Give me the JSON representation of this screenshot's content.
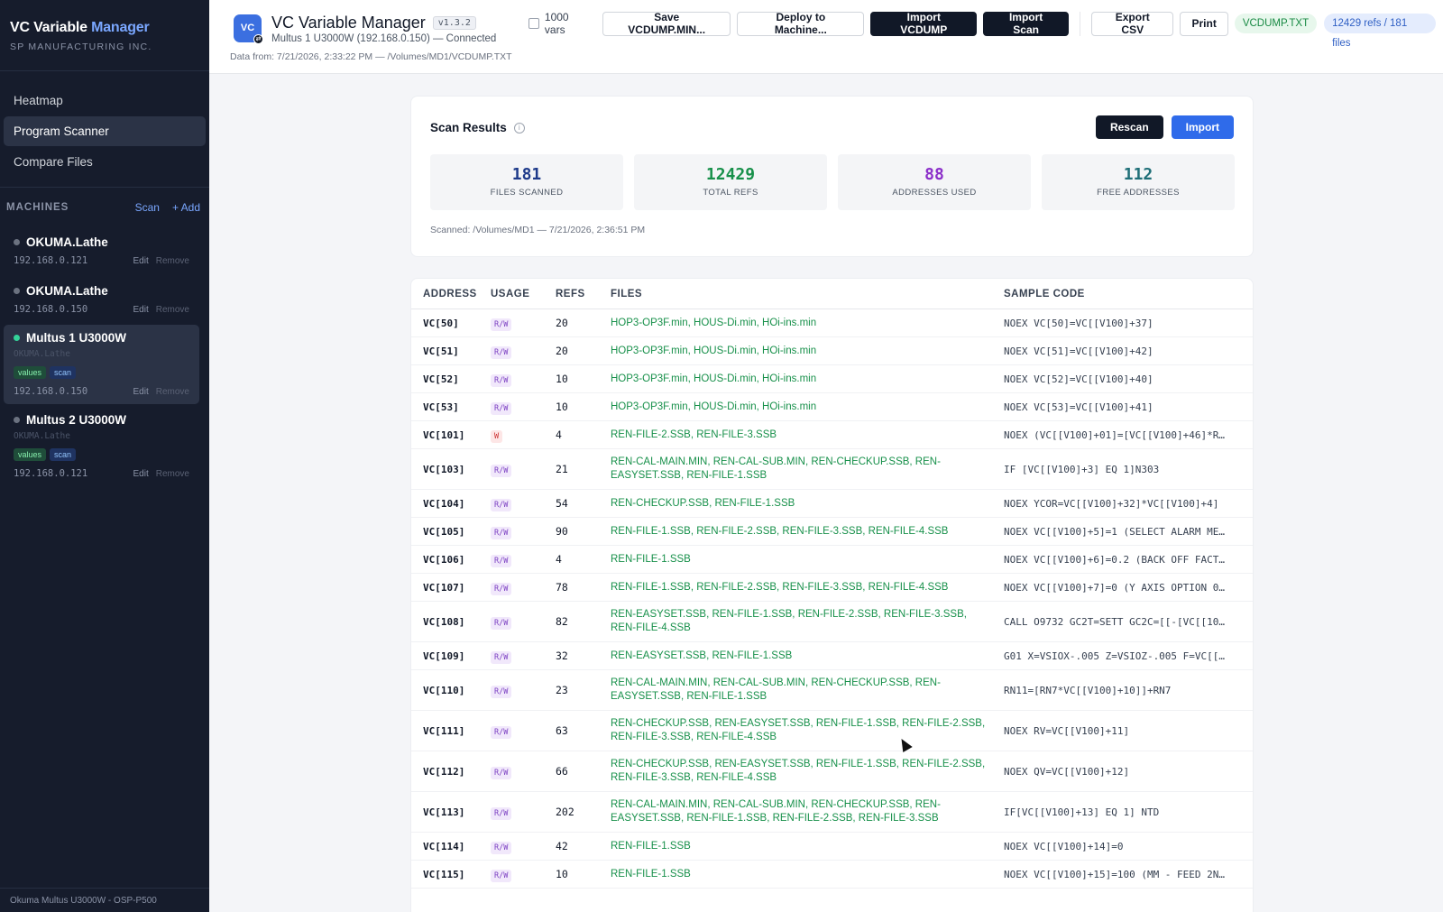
{
  "brand": {
    "title_a": "VC Variable",
    "title_b": "Manager",
    "subtitle": "SP MANUFACTURING INC."
  },
  "nav": [
    {
      "label": "Heatmap",
      "active": false
    },
    {
      "label": "Program Scanner",
      "active": true
    },
    {
      "label": "Compare Files",
      "active": false
    }
  ],
  "machines_header": {
    "label": "MACHINES",
    "scan": "Scan",
    "add": "+ Add"
  },
  "machines": [
    {
      "name": "OKUMA.Lathe",
      "sub": "",
      "ip": "192.168.0.121",
      "online": false,
      "tags": [],
      "edit": "Edit",
      "remove": "Remove"
    },
    {
      "name": "OKUMA.Lathe",
      "sub": "",
      "ip": "192.168.0.150",
      "online": false,
      "tags": [],
      "edit": "Edit",
      "remove": "Remove"
    },
    {
      "name": "Multus 1 U3000W",
      "sub": "OKUMA.Lathe",
      "ip": "192.168.0.150",
      "online": true,
      "tags": [
        "values",
        "scan"
      ],
      "edit": "Edit",
      "remove": "Remove",
      "active": true
    },
    {
      "name": "Multus 2 U3000W",
      "sub": "OKUMA.Lathe",
      "ip": "192.168.0.121",
      "online": false,
      "tags": [
        "values",
        "scan"
      ],
      "edit": "Edit",
      "remove": "Remove"
    }
  ],
  "sidebar_footer": "Okuma Multus U3000W - OSP-P500",
  "header": {
    "icon_text": "VC",
    "title": "VC Variable Manager",
    "version": "v1.3.2",
    "subtitle": "Multus 1 U3000W (192.168.0.150) — Connected",
    "data_from": "Data from: 7/21/2026, 2:33:22 PM — /Volumes/MD1/VCDUMP.TXT",
    "checkbox_label": "1000 vars",
    "buttons": {
      "save": "Save VCDUMP.MIN...",
      "deploy": "Deploy to Machine...",
      "import_vcdump": "Import VCDUMP",
      "import_scan": "Import Scan",
      "export_csv": "Export CSV",
      "print": "Print"
    },
    "file_pill": "VCDUMP.TXT",
    "refs_pill": "12429 refs / 181 files"
  },
  "scan": {
    "title": "Scan Results",
    "rescan": "Rescan",
    "import": "Import",
    "stats": [
      {
        "value": "181",
        "label": "FILES SCANNED",
        "color": "#1e3a8a"
      },
      {
        "value": "12429",
        "label": "TOTAL REFS",
        "color": "#17904a"
      },
      {
        "value": "88",
        "label": "ADDRESSES USED",
        "color": "#8b2fc9"
      },
      {
        "value": "112",
        "label": "FREE ADDRESSES",
        "color": "#1f6f78"
      }
    ],
    "footer": "Scanned: /Volumes/MD1 — 7/21/2026, 2:36:51 PM"
  },
  "table": {
    "columns": [
      "ADDRESS",
      "USAGE",
      "REFS",
      "FILES",
      "SAMPLE CODE"
    ],
    "rows": [
      {
        "addr": "VC[50]",
        "usage": "R/W",
        "refs": "20",
        "files": "HOP3-OP3F.min, HOUS-Di.min, HOi-ins.min",
        "code": "NOEX VC[50]=VC[[V100]+37]"
      },
      {
        "addr": "VC[51]",
        "usage": "R/W",
        "refs": "20",
        "files": "HOP3-OP3F.min, HOUS-Di.min, HOi-ins.min",
        "code": "NOEX VC[51]=VC[[V100]+42]"
      },
      {
        "addr": "VC[52]",
        "usage": "R/W",
        "refs": "10",
        "files": "HOP3-OP3F.min, HOUS-Di.min, HOi-ins.min",
        "code": "NOEX VC[52]=VC[[V100]+40]"
      },
      {
        "addr": "VC[53]",
        "usage": "R/W",
        "refs": "10",
        "files": "HOP3-OP3F.min, HOUS-Di.min, HOi-ins.min",
        "code": "NOEX VC[53]=VC[[V100]+41]"
      },
      {
        "addr": "VC[101]",
        "usage": "W",
        "refs": "4",
        "files": "REN-FILE-2.SSB, REN-FILE-3.SSB",
        "code": "NOEX (VC[[V100]+01]=[VC[[V100]+46]*R…"
      },
      {
        "addr": "VC[103]",
        "usage": "R/W",
        "refs": "21",
        "files": "REN-CAL-MAIN.MIN, REN-CAL-SUB.MIN, REN-CHECKUP.SSB, REN-EASYSET.SSB, REN-FILE-1.SSB",
        "code": "IF [VC[[V100]+3] EQ 1]N303"
      },
      {
        "addr": "VC[104]",
        "usage": "R/W",
        "refs": "54",
        "files": "REN-CHECKUP.SSB, REN-FILE-1.SSB",
        "code": "NOEX YCOR=VC[[V100]+32]*VC[[V100]+4]"
      },
      {
        "addr": "VC[105]",
        "usage": "R/W",
        "refs": "90",
        "files": "REN-FILE-1.SSB, REN-FILE-2.SSB, REN-FILE-3.SSB, REN-FILE-4.SSB",
        "code": "NOEX VC[[V100]+5]=1 (SELECT ALARM ME…"
      },
      {
        "addr": "VC[106]",
        "usage": "R/W",
        "refs": "4",
        "files": "REN-FILE-1.SSB",
        "code": "NOEX VC[[V100]+6]=0.2 (BACK OFF FACT…"
      },
      {
        "addr": "VC[107]",
        "usage": "R/W",
        "refs": "78",
        "files": "REN-FILE-1.SSB, REN-FILE-2.SSB, REN-FILE-3.SSB, REN-FILE-4.SSB",
        "code": "NOEX VC[[V100]+7]=0 (Y AXIS OPTION 0…"
      },
      {
        "addr": "VC[108]",
        "usage": "R/W",
        "refs": "82",
        "files": "REN-EASYSET.SSB, REN-FILE-1.SSB, REN-FILE-2.SSB, REN-FILE-3.SSB, REN-FILE-4.SSB",
        "code": "CALL O9732 GC2T=SETT GC2C=[[-[VC[[10…"
      },
      {
        "addr": "VC[109]",
        "usage": "R/W",
        "refs": "32",
        "files": "REN-EASYSET.SSB, REN-FILE-1.SSB",
        "code": "G01 X=VSIOX-.005 Z=VSIOZ-.005 F=VC[[…"
      },
      {
        "addr": "VC[110]",
        "usage": "R/W",
        "refs": "23",
        "files": "REN-CAL-MAIN.MIN, REN-CAL-SUB.MIN, REN-CHECKUP.SSB, REN-EASYSET.SSB, REN-FILE-1.SSB",
        "code": "RN11=[RN7*VC[[V100]+10]]+RN7"
      },
      {
        "addr": "VC[111]",
        "usage": "R/W",
        "refs": "63",
        "files": "REN-CHECKUP.SSB, REN-EASYSET.SSB, REN-FILE-1.SSB, REN-FILE-2.SSB, REN-FILE-3.SSB, REN-FILE-4.SSB",
        "code": "NOEX RV=VC[[V100]+11]"
      },
      {
        "addr": "VC[112]",
        "usage": "R/W",
        "refs": "66",
        "files": "REN-CHECKUP.SSB, REN-EASYSET.SSB, REN-FILE-1.SSB, REN-FILE-2.SSB, REN-FILE-3.SSB, REN-FILE-4.SSB",
        "code": "NOEX QV=VC[[V100]+12]"
      },
      {
        "addr": "VC[113]",
        "usage": "R/W",
        "refs": "202",
        "files": "REN-CAL-MAIN.MIN, REN-CAL-SUB.MIN, REN-CHECKUP.SSB, REN-EASYSET.SSB, REN-FILE-1.SSB, REN-FILE-2.SSB, REN-FILE-3.SSB",
        "code": "IF[VC[[V100]+13] EQ 1] NTD"
      },
      {
        "addr": "VC[114]",
        "usage": "R/W",
        "refs": "42",
        "files": "REN-FILE-1.SSB",
        "code": "NOEX VC[[V100]+14]=0"
      },
      {
        "addr": "VC[115]",
        "usage": "R/W",
        "refs": "10",
        "files": "REN-FILE-1.SSB",
        "code": "NOEX VC[[V100]+15]=100 (MM - FEED 2N…"
      }
    ]
  }
}
